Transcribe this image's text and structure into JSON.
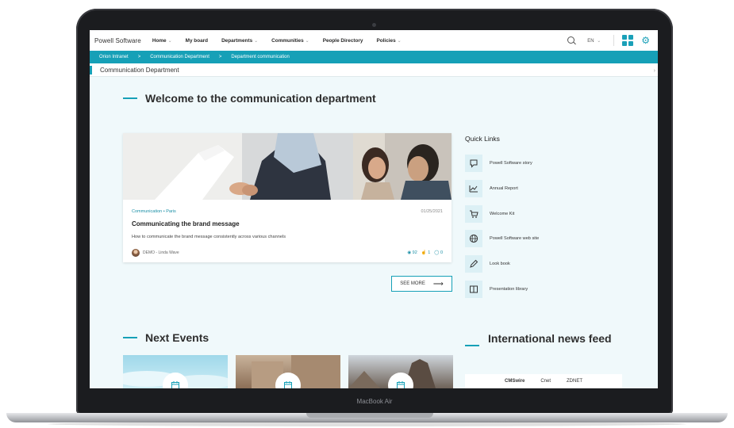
{
  "device": {
    "model_label": "MacBook Air"
  },
  "topnav": {
    "brand": "Powell Software",
    "menu": [
      {
        "label": "Home",
        "has_chevron": true
      },
      {
        "label": "My board",
        "has_chevron": false
      },
      {
        "label": "Departments",
        "has_chevron": true
      },
      {
        "label": "Communities",
        "has_chevron": true
      },
      {
        "label": "People Directory",
        "has_chevron": false
      },
      {
        "label": "Policies",
        "has_chevron": true
      }
    ],
    "language": "EN",
    "icons": [
      "search-icon",
      "app-launcher-icon",
      "gear-icon"
    ]
  },
  "breadcrumb": [
    "Orion Intranet",
    "Communication Department",
    "Department communication"
  ],
  "page": {
    "title": "Communication Department"
  },
  "welcome": {
    "title": "Welcome to the communication department"
  },
  "news_card": {
    "meta": "Communication • Paris",
    "date": "01/25/2021",
    "title": "Communicating the brand message",
    "description": "How to communicate the brand message consistently across various channels",
    "author": "DEMO - Linda Wave",
    "views": "92",
    "likes": "1",
    "comments": "0"
  },
  "see_more": {
    "label": "SEE MORE"
  },
  "quick_links": {
    "title": "Quick Links",
    "items": [
      {
        "label": "Powell Software story",
        "icon": "chat-icon"
      },
      {
        "label": "Annual Report",
        "icon": "chart-icon"
      },
      {
        "label": "Welcome Kit",
        "icon": "cart-icon"
      },
      {
        "label": "Powell Software web site",
        "icon": "globe-icon"
      },
      {
        "label": "Look book",
        "icon": "pen-icon"
      },
      {
        "label": "Presentation library",
        "icon": "book-icon"
      }
    ]
  },
  "events": {
    "title": "Next Events"
  },
  "intl_news": {
    "title": "International news feed",
    "tabs": [
      "CMSwire",
      "Cnet",
      "ZDNET"
    ],
    "active_tab": "CMSwire"
  },
  "colors": {
    "accent": "#16a0b7",
    "page_bg": "#f0f9fb"
  }
}
